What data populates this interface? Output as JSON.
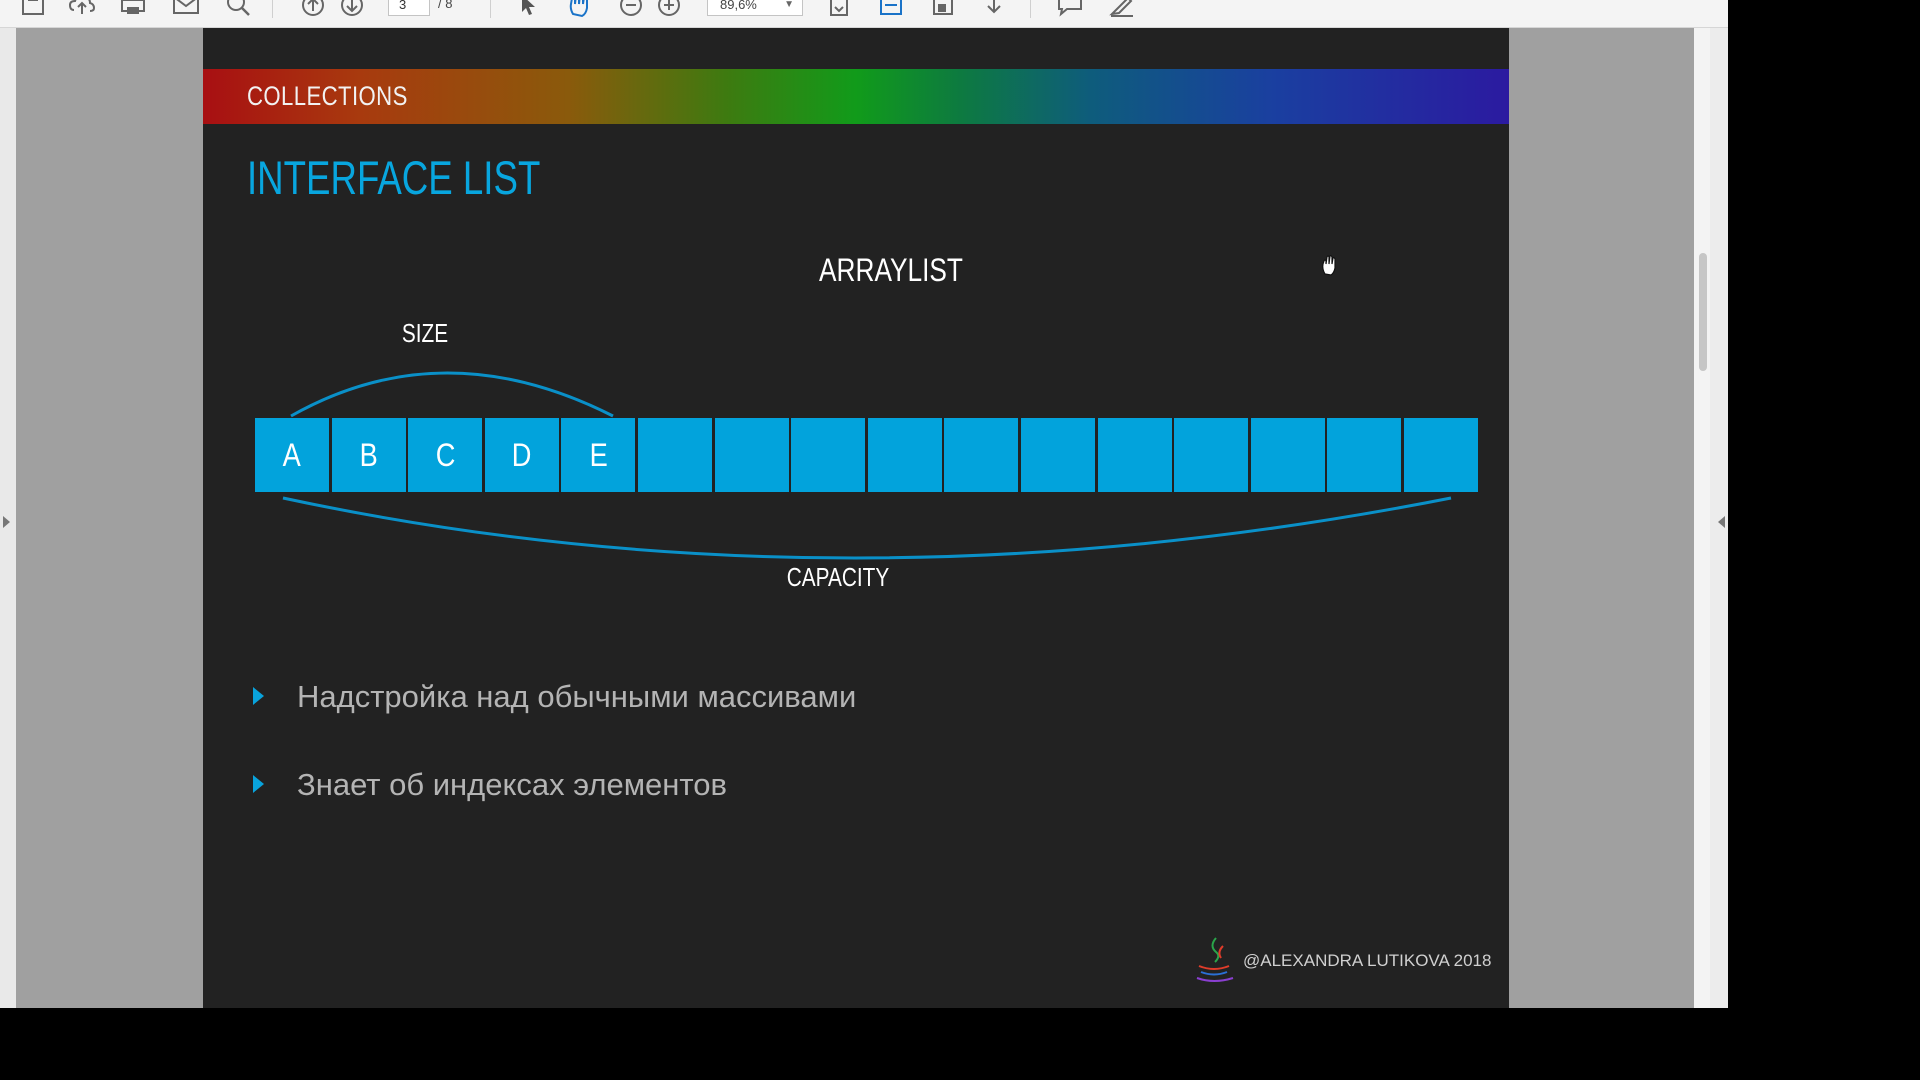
{
  "toolbar": {
    "icons": [
      "save-icon",
      "upload-icon",
      "print-icon",
      "mail-icon",
      "search-icon",
      "page-up-icon",
      "page-down-icon",
      "select-cursor-icon",
      "hand-tool-icon",
      "zoom-out-icon",
      "zoom-in-icon",
      "fit-page-icon",
      "fit-width-icon",
      "rotate-icon",
      "download-icon",
      "comment-icon",
      "sign-icon"
    ],
    "current_page": "3",
    "total_pages": "/ 8",
    "zoom": "89,6%"
  },
  "slide": {
    "section_title": "COLLECTIONS",
    "title": "INTERFACE LIST",
    "diagram": {
      "title": "ARRAYLIST",
      "size_label": "SIZE",
      "capacity_label": "CAPACITY",
      "cells": [
        "A",
        "B",
        "C",
        "D",
        "E",
        "",
        "",
        "",
        "",
        "",
        "",
        "",
        "",
        "",
        "",
        ""
      ]
    },
    "bullets": [
      "Надстройка над обычными массивами",
      "Знает об индексах элементов"
    ],
    "footer": "@ALEXANDRA LUTIKOVA 2018"
  },
  "colors": {
    "accent": "#02a3dc",
    "slide_background": "#222222",
    "bullet_text": "#b4b4b4"
  }
}
